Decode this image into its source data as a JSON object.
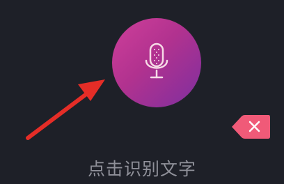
{
  "voice_input": {
    "mic_icon": "microphone-icon",
    "hint_text": "点击识别文字",
    "accent_gradient": [
      "#cf3f9a",
      "#7e2f9f"
    ]
  },
  "delete_button": {
    "icon": "close-icon",
    "color": "#f05a78"
  },
  "annotation": {
    "arrow_color": "#e52d27"
  },
  "background_color": "#1e2028"
}
